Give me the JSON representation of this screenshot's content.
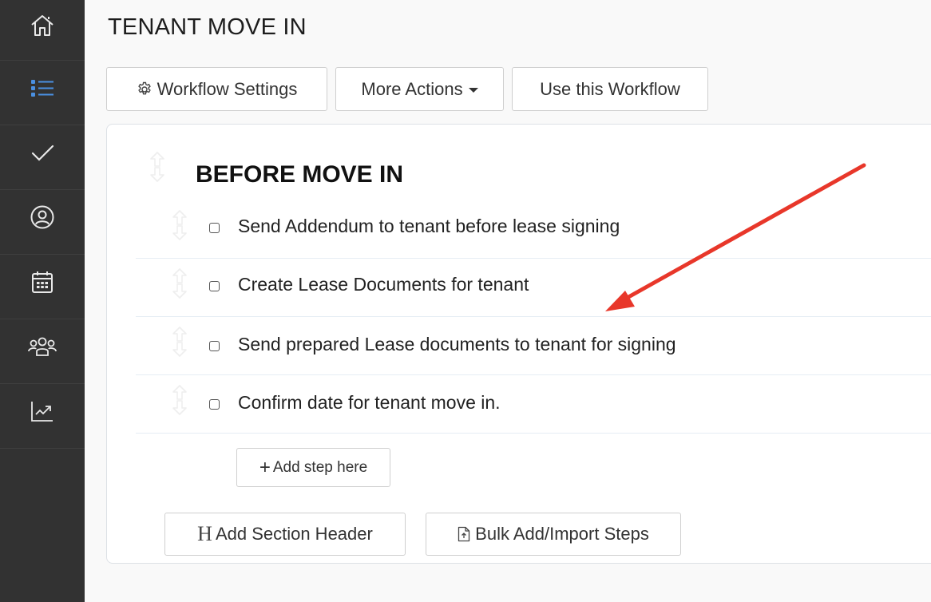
{
  "sidebar": {
    "items": [
      {
        "name": "home",
        "icon": "home-icon",
        "active": false
      },
      {
        "name": "workflows",
        "icon": "list-icon",
        "active": true
      },
      {
        "name": "tasks",
        "icon": "check-icon",
        "active": false
      },
      {
        "name": "profile",
        "icon": "user-circle-icon",
        "active": false
      },
      {
        "name": "calendar",
        "icon": "calendar-icon",
        "active": false
      },
      {
        "name": "team",
        "icon": "users-icon",
        "active": false
      },
      {
        "name": "reports",
        "icon": "chart-line-icon",
        "active": false
      }
    ],
    "active_color": "#4a90e2",
    "icon_color": "#e8e8e8"
  },
  "header": {
    "title": "TENANT MOVE IN"
  },
  "toolbar": {
    "workflow_settings_label": "Workflow Settings",
    "more_actions_label": "More Actions",
    "use_workflow_label": "Use this Workflow"
  },
  "workflow": {
    "section_title": "BEFORE MOVE IN",
    "steps": [
      {
        "label": "Send Addendum to tenant before lease signing",
        "checked": false
      },
      {
        "label": "Create Lease Documents for tenant",
        "checked": false
      },
      {
        "label": "Send prepared Lease documents to tenant for signing",
        "checked": false
      },
      {
        "label": "Confirm date for tenant move in.",
        "checked": false
      }
    ],
    "add_step_label": "Add step here",
    "add_section_header_label": "Add Section Header",
    "bulk_add_label": "Bulk Add/Import Steps"
  },
  "annotation": {
    "arrow_color": "#e8372a"
  }
}
